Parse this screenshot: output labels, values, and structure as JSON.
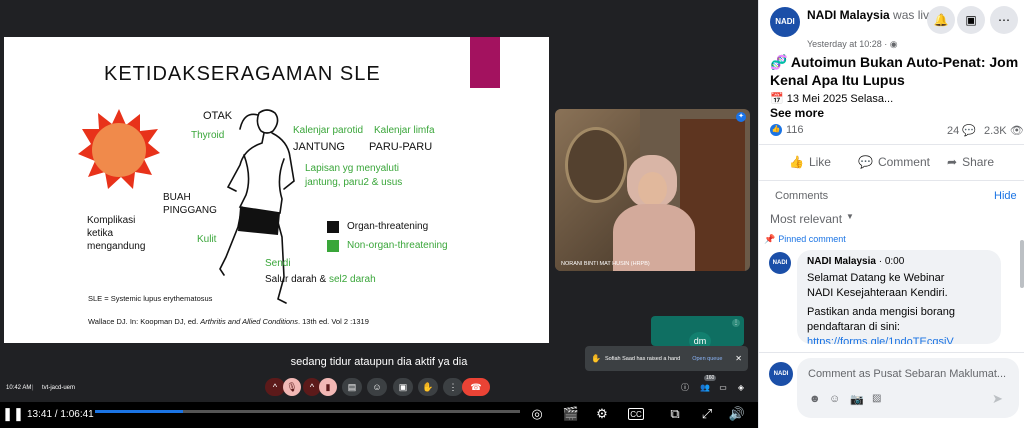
{
  "slide": {
    "title": "KETIDAKSERAGAMAN SLE",
    "labels": {
      "otak": "OTAK",
      "thyroid": "Thyroid",
      "kalenjar_parotid": "Kalenjar parotid",
      "kalenjar_limfa": "Kalenjar limfa",
      "jantung": "JANTUNG",
      "paru_paru": "PARU-PARU",
      "lapisan_1": "Lapisan yg menyaluti",
      "lapisan_2": "jantung, paru2 & usus",
      "buah_pinggang_1": "BUAH",
      "buah_pinggang_2": "PINGGANG",
      "komplikasi_1": "Komplikasi",
      "komplikasi_2": "ketika",
      "komplikasi_3": "mengandung",
      "kulit": "Kulit",
      "sendi": "Sendi",
      "salur_darah": "Salur darah & ",
      "sel2_darah": "sel2 darah"
    },
    "legend": {
      "organ": "Organ-threatening",
      "non_organ": "Non-organ-threatening"
    },
    "footnote": "SLE = Systemic lupus erythematosus",
    "reference_plain": "Wallace DJ. In: Koopman DJ, ed. ",
    "reference_italic": "Arthritis and Allied Conditions",
    "reference_end": ". 13th ed. Vol 2 :1319"
  },
  "participant": {
    "name": "NORANI BINTI MAT HUSIN (HRPB)",
    "tile_initials": "dm"
  },
  "caption": "sedang tidur ataupun dia aktif ya dia",
  "toast": {
    "text": "Sofiah Saad has raised a hand",
    "action": "Open queue"
  },
  "meet": {
    "time": "10:42 AM",
    "code": "tvt-jacd-uem",
    "people_count": "160"
  },
  "player": {
    "current_time": "13:41",
    "separator": " / ",
    "duration": "1:06:41",
    "progress": 0.206
  },
  "post": {
    "page_name": "NADI Malaysia",
    "status": " was live.",
    "timestamp": "Yesterday at 10:28 · ",
    "title": "Autoimun Bukan Auto-Penat: Jom Kenal Apa Itu Lupus",
    "date_line": "13 Mei 2025 Selasa...",
    "see_more": "See more",
    "reactions": "116",
    "comments_count": "24",
    "views": "2.3K",
    "like": "Like",
    "comment": "Comment",
    "share": "Share"
  },
  "comments_section": {
    "label": "Comments",
    "hide": "Hide",
    "sort": "Most relevant",
    "pinned": "Pinned comment",
    "first_comment": {
      "author": "NADI Malaysia",
      "time": "0:00",
      "line1": "Selamat Datang ke Webinar",
      "line2": "NADI Kesejahteraan Kendiri.",
      "line3": "Pastikan anda mengisi borang",
      "line4": "pendaftaran di sini:",
      "link": "https://forms.gle/1ndoTEcqsiV"
    },
    "input_placeholder": "Comment as Pusat Sebaran Maklumat..."
  },
  "colors": {
    "facebook_blue": "#1b74e4",
    "slide_green": "#3aa63a",
    "magenta": "#a3125f",
    "sun_orange": "#f08a4b",
    "sun_red": "#e8321a"
  }
}
